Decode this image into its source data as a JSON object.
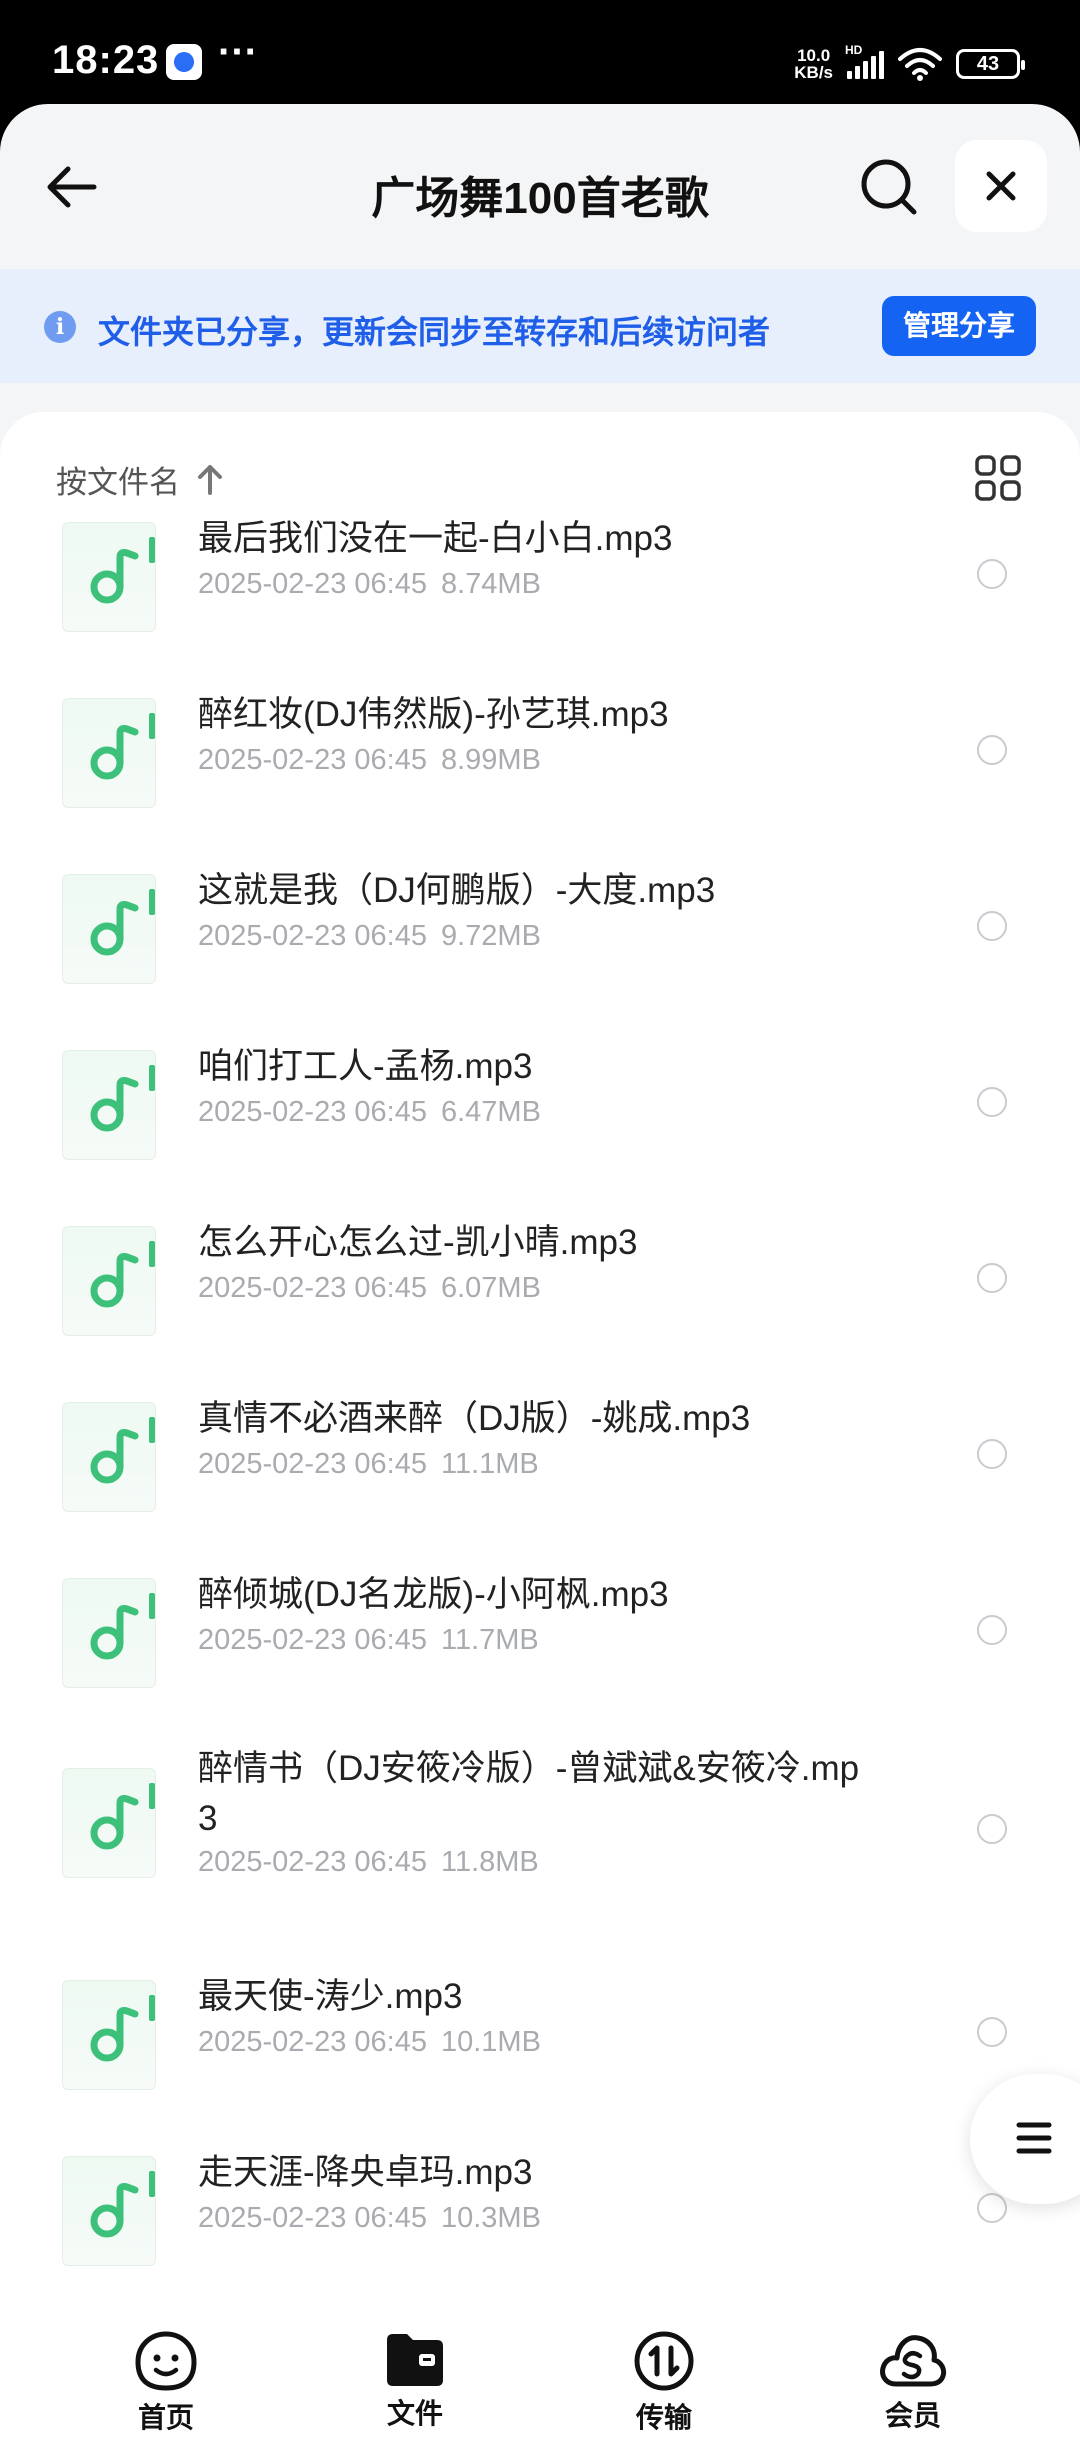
{
  "status_bar": {
    "time": "18:23",
    "more": "···",
    "net_speed_value": "10.0",
    "net_speed_unit": "KB/s",
    "hd": "HD",
    "battery": "43"
  },
  "header": {
    "title": "广场舞100首老歌",
    "back_icon": "arrow-left-icon",
    "search_icon": "search-icon",
    "close_icon": "close-icon"
  },
  "share_banner": {
    "info_glyph": "i",
    "text": "文件夹已分享，更新会同步至转存和后续访问者",
    "button": "管理分享"
  },
  "sort": {
    "label": "按文件名",
    "direction_icon": "arrow-up-icon",
    "view_icon": "grid-view-icon"
  },
  "files": [
    {
      "name": "最后我们没在一起-白小白.mp3",
      "date": "2025-02-23 06:45",
      "size": "8.74MB"
    },
    {
      "name": "醉红妆(DJ伟然版)-孙艺琪.mp3",
      "date": "2025-02-23 06:45",
      "size": "8.99MB"
    },
    {
      "name": "这就是我（DJ何鹏版）-大度.mp3",
      "date": "2025-02-23 06:45",
      "size": "9.72MB"
    },
    {
      "name": "咱们打工人-孟杨.mp3",
      "date": "2025-02-23 06:45",
      "size": "6.47MB"
    },
    {
      "name": "怎么开心怎么过-凯小晴.mp3",
      "date": "2025-02-23 06:45",
      "size": "6.07MB"
    },
    {
      "name": "真情不必酒来醉（DJ版）-姚成.mp3",
      "date": "2025-02-23 06:45",
      "size": "11.1MB"
    },
    {
      "name": "醉倾城(DJ名龙版)-小阿枫.mp3",
      "date": "2025-02-23 06:45",
      "size": "11.7MB"
    },
    {
      "name": "醉情书（DJ安筱冷版）-曾斌斌&安筱冷.mp3",
      "date": "2025-02-23 06:45",
      "size": "11.8MB"
    },
    {
      "name": "最天使-涛少.mp3",
      "date": "2025-02-23 06:45",
      "size": "10.1MB"
    },
    {
      "name": "走天涯-降央卓玛.mp3",
      "date": "2025-02-23 06:45",
      "size": "10.3MB"
    }
  ],
  "bottom_nav": [
    {
      "label": "首页",
      "icon": "home-face-icon"
    },
    {
      "label": "文件",
      "icon": "folder-icon",
      "active": true
    },
    {
      "label": "传输",
      "icon": "transfer-icon"
    },
    {
      "label": "会员",
      "icon": "cloud-member-icon"
    }
  ],
  "colors": {
    "accent": "#1463f3",
    "banner_bg": "#e7eefc",
    "music_green": "#3cc07a"
  }
}
